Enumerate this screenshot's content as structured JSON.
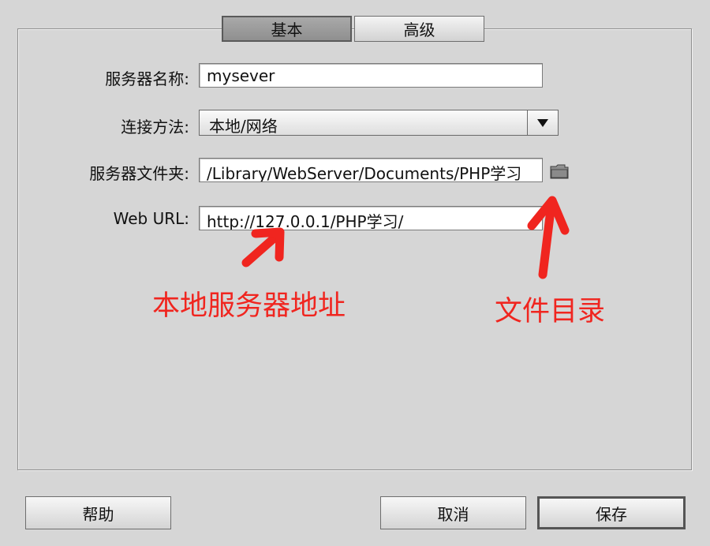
{
  "tabs": [
    {
      "label": "基本",
      "active": true
    },
    {
      "label": "高级",
      "active": false
    }
  ],
  "form": {
    "server_name_label": "服务器名称:",
    "server_name_value": "mysever",
    "connection_label": "连接方法:",
    "connection_value": "本地/网络",
    "folder_label": "服务器文件夹:",
    "folder_value": "/Library/WebServer/Documents/PHP学习",
    "url_label": "Web URL:",
    "url_value": "http://127.0.0.1/PHP学习/"
  },
  "annotations": {
    "local_server_address": "本地服务器地址",
    "file_directory": "文件目录",
    "color": "#f0251f"
  },
  "buttons": {
    "help": "帮助",
    "cancel": "取消",
    "save": "保存"
  },
  "icons": {
    "folder": "folder-icon",
    "dropdown": "triangle-down-icon"
  }
}
